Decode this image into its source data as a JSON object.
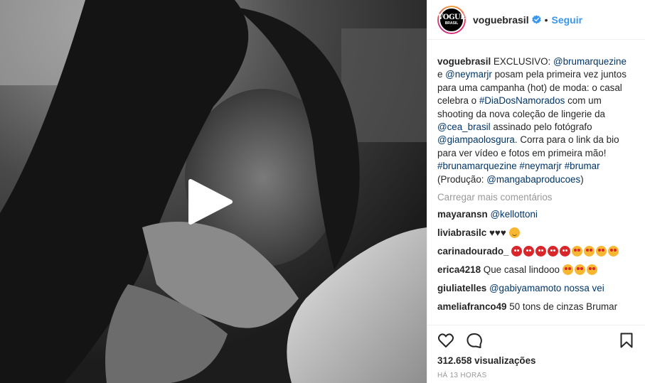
{
  "post": {
    "username": "voguebrasil",
    "follow_label": "Seguir",
    "separator": "•",
    "avatar": {
      "line1": "VOGUE",
      "line2": "BRASIL"
    },
    "caption": {
      "user": "voguebrasil",
      "parts": [
        "EXCLUSIVO: ",
        "@brumarquezine",
        " e ",
        "@neymarjr",
        " posam pela primeira vez juntos para uma campanha (hot) de moda: o casal celebra o ",
        "#DiaDosNamorados",
        " com um shooting da nova coleção de lingerie da ",
        "@cea_brasil",
        " assinado pelo fotógrafo ",
        "@giampaolosgura",
        ". Corra para o link da bio para ver vídeo e fotos em primeira mão! ",
        "#brunamarquezine",
        " ",
        "#neymarjr",
        " ",
        "#brumar",
        " (Produção: ",
        "@mangabaproducoes",
        ")"
      ]
    },
    "load_more_label": "Carregar mais comentários",
    "comments": [
      {
        "user": "mayaransn",
        "text": "@kellottoni",
        "emoji": []
      },
      {
        "user": "liviabrasilc",
        "text": "♥♥♥",
        "emoji": [
          "smile"
        ]
      },
      {
        "user": "carinadourado_",
        "text": "",
        "emoji": [
          "devil",
          "devil",
          "devil",
          "devil",
          "devil",
          "heart",
          "heart",
          "heart",
          "heart"
        ]
      },
      {
        "user": "erica4218",
        "text": "Que casal lindooo",
        "emoji": [
          "heart",
          "heart",
          "heart"
        ]
      },
      {
        "user": "giuliatelles",
        "text": "@gabiyamamoto nossa vei",
        "emoji": []
      },
      {
        "user": "ameliafranco49",
        "text": "50 tons de cinzas Brumar",
        "emoji": []
      }
    ],
    "views_count": "312.658",
    "views_label": "visualizações",
    "time_label": "HÁ 13 HORAS"
  },
  "icons": {
    "like": "heart-outline-icon",
    "comment": "speech-bubble-icon",
    "save": "bookmark-icon",
    "play": "play-icon",
    "verified": "verified-badge-icon"
  },
  "colors": {
    "link": "#003569",
    "follow": "#3897f0",
    "verified": "#3897f0",
    "muted": "#999999"
  }
}
